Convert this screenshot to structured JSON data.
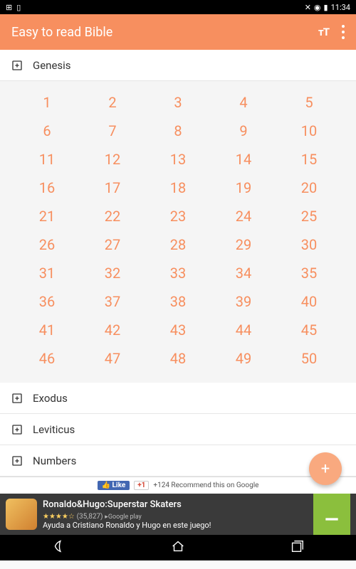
{
  "statusbar": {
    "time": "11:34"
  },
  "appbar": {
    "title": "Easy to read Bible",
    "text_size_label": "тT"
  },
  "books": [
    {
      "name": "Genesis",
      "expanded": true,
      "chapters": [
        1,
        2,
        3,
        4,
        5,
        6,
        7,
        8,
        9,
        10,
        11,
        12,
        13,
        14,
        15,
        16,
        17,
        18,
        19,
        20,
        21,
        22,
        23,
        24,
        25,
        26,
        27,
        28,
        29,
        30,
        31,
        32,
        33,
        34,
        35,
        36,
        37,
        38,
        39,
        40,
        41,
        42,
        43,
        44,
        45,
        46,
        47,
        48,
        49,
        50
      ]
    },
    {
      "name": "Exodus",
      "expanded": false
    },
    {
      "name": "Leviticus",
      "expanded": false
    },
    {
      "name": "Numbers",
      "expanded": false
    }
  ],
  "fab": {
    "label": "+"
  },
  "social": {
    "fb": "Like",
    "gp": "+1",
    "google_recommend": "+124 Recommend this on Google"
  },
  "ad": {
    "title": "Ronaldo&Hugo:Superstar Skaters",
    "reviews": "(35,827)",
    "store": "Google play",
    "subtitle": "Ayuda a Cristiano Ronaldo y Hugo en este juego!"
  }
}
